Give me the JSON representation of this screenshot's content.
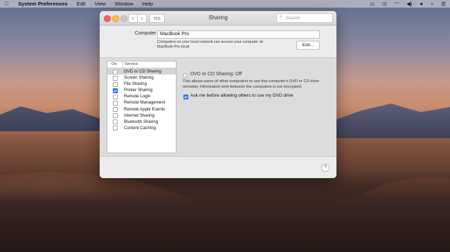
{
  "menubar": {
    "apple_icon": "",
    "app_name": "System Preferences",
    "menus": [
      "Edit",
      "View",
      "Window",
      "Help"
    ],
    "status_icons": [
      "airplay-icon",
      "time-machine-icon",
      "wifi-icon",
      "volume-icon",
      "user-icon",
      "spotlight-icon",
      "menu-list-icon"
    ]
  },
  "window": {
    "title": "Sharing",
    "search": {
      "placeholder": "Search",
      "value": ""
    }
  },
  "computer_name": {
    "label": "Computer Name:",
    "value": "MacBook Pro",
    "note_line1": "Computers on your local network can access your computer at:",
    "note_line2": "MacBook-Pro.local",
    "edit_label": "Edit..."
  },
  "services": {
    "headers": {
      "on": "On",
      "service": "Service"
    },
    "items": [
      {
        "name": "DVD or CD Sharing",
        "checked": false,
        "selected": true
      },
      {
        "name": "Screen Sharing",
        "checked": false,
        "selected": false
      },
      {
        "name": "File Sharing",
        "checked": false,
        "selected": false
      },
      {
        "name": "Printer Sharing",
        "checked": true,
        "selected": false
      },
      {
        "name": "Remote Login",
        "checked": false,
        "selected": false
      },
      {
        "name": "Remote Management",
        "checked": false,
        "selected": false
      },
      {
        "name": "Remote Apple Events",
        "checked": false,
        "selected": false
      },
      {
        "name": "Internet Sharing",
        "checked": false,
        "selected": false
      },
      {
        "name": "Bluetooth Sharing",
        "checked": false,
        "selected": false
      },
      {
        "name": "Content Caching",
        "checked": false,
        "selected": false
      }
    ]
  },
  "detail": {
    "status": "DVD or CD Sharing: Off",
    "description": "This allows users of other computers to use this computer's DVD or CD drive remotely. Information sent between the computers is not encrypted.",
    "ask_label": "Ask me before allowing others to use my DVD drive",
    "ask_checked": true
  },
  "help_label": "?"
}
